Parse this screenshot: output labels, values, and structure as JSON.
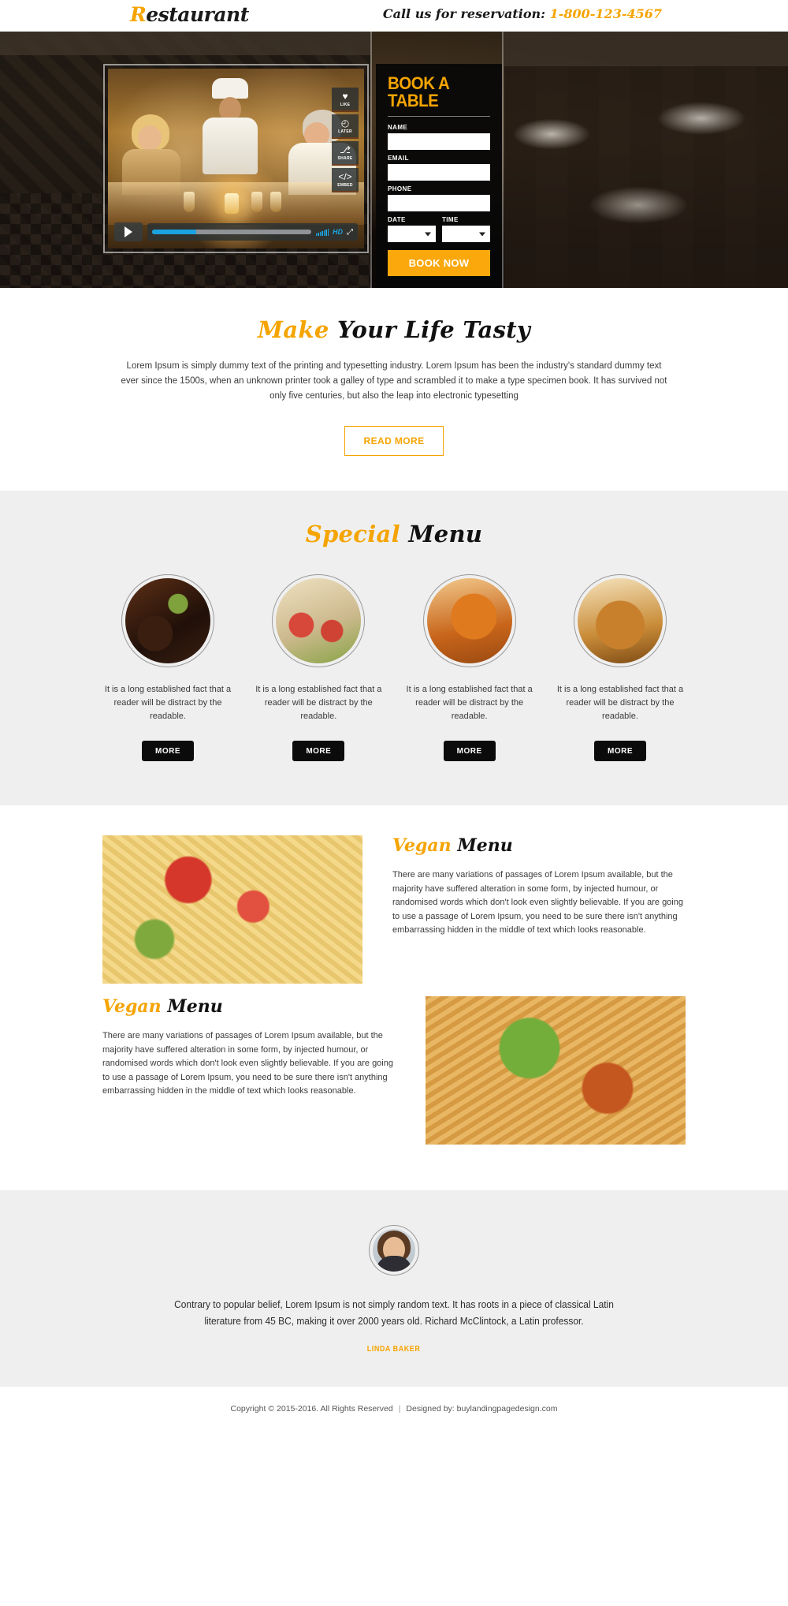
{
  "header": {
    "logo_prefix": "R",
    "logo_rest": "estaurant",
    "call_label": "Call us for reservation: ",
    "phone": "1-800-123-4567"
  },
  "hero": {
    "video": {
      "actions": [
        {
          "icon": "heart-icon",
          "glyph": "♥",
          "label": "LIKE"
        },
        {
          "icon": "clock-icon",
          "glyph": "◴",
          "label": "LATER"
        },
        {
          "icon": "share-icon",
          "glyph": "⎇",
          "label": "SHARE"
        },
        {
          "icon": "embed-icon",
          "glyph": "</>",
          "label": "EMBED"
        }
      ],
      "play_label": "Play",
      "progress_percent": 28,
      "quality_label": "HD",
      "fullscreen_label": "⤢"
    },
    "booking": {
      "title": "BOOK A TABLE",
      "name_label": "NAME",
      "name_value": "",
      "name_placeholder": "",
      "email_label": "EMAIL",
      "email_value": "",
      "email_placeholder": "",
      "phone_label": "PHONE",
      "phone_value": "",
      "phone_placeholder": "",
      "date_label": "DATE",
      "date_value": "",
      "time_label": "TIME",
      "time_value": "",
      "submit_label": "BOOK NOW"
    }
  },
  "tasty": {
    "heading_hl": "Make",
    "heading_rest": " Your Life Tasty",
    "paragraph": "Lorem Ipsum is simply dummy text of the printing and typesetting industry. Lorem Ipsum has been the industry's standard dummy text ever since the 1500s, when an unknown printer took a galley of type and scrambled it to make a type specimen book. It has survived not only five centuries, but also the leap into electronic typesetting",
    "read_more": "READ MORE"
  },
  "special": {
    "heading_hl": "Special",
    "heading_rest": " Menu",
    "cards": [
      {
        "image": "grilled-lamb-chops",
        "text": "It is a long established fact that a reader will be distract by the readable.",
        "button": "MORE"
      },
      {
        "image": "veggie-wraps",
        "text": "It is a long established fact that a reader will be distract by the readable.",
        "button": "MORE"
      },
      {
        "image": "curry-chicken",
        "text": "It is a long established fact that a reader will be distract by the readable.",
        "button": "MORE"
      },
      {
        "image": "roast-turkey",
        "text": "It is a long established fact that a reader will be distract by the readable.",
        "button": "MORE"
      }
    ]
  },
  "vegan": {
    "blocks": [
      {
        "image": "seafood-pasta",
        "heading_hl": "Vegan",
        "heading_rest": " Menu",
        "paragraph": "There are many variations of passages of Lorem Ipsum available, but the majority have suffered alteration in some form, by injected humour, or randomised words which don't look even slightly believable. If you are going to use a passage of Lorem Ipsum, you need to be sure there isn't anything embarrassing hidden in the middle of text which looks reasonable."
      },
      {
        "image": "spaghetti-bolognese",
        "heading_hl": "Vegan",
        "heading_rest": " Menu",
        "paragraph": "There are many variations of passages of Lorem Ipsum available, but the majority have suffered alteration in some form, by injected humour, or randomised words which don't look even slightly believable. If you are going to use a passage of Lorem Ipsum, you need to be sure there isn't anything embarrassing hidden in the middle of text which looks reasonable."
      }
    ]
  },
  "testimonial": {
    "avatar": "customer-avatar",
    "quote": "Contrary to popular belief, Lorem Ipsum is not simply random text. It has roots in a piece of classical Latin literature from 45 BC, making it over 2000 years old. Richard McClintock, a Latin professor.",
    "author": "LINDA BAKER"
  },
  "footer": {
    "copyright": "Copyright © 2015-2016. All Rights Reserved",
    "separator": "|",
    "designed_by": "Designed by: buylandingpagedesign.com"
  },
  "colors": {
    "accent": "#f5a400",
    "button": "#faa80b",
    "dark": "#0b0b0b",
    "light_section": "#efefef",
    "video_blue": "#1ba2e0"
  }
}
